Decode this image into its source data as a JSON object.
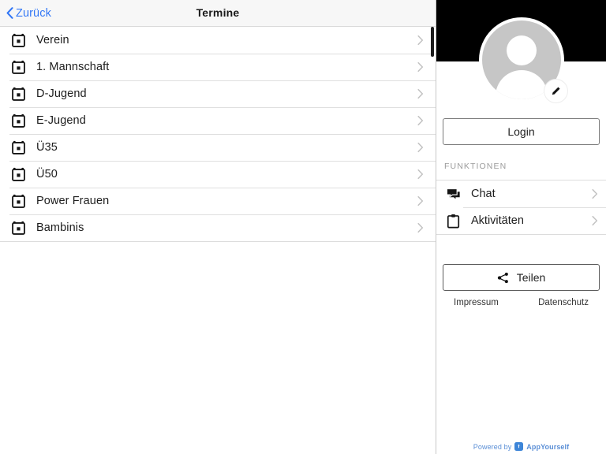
{
  "navbar": {
    "back_label": "Zurück",
    "title": "Termine"
  },
  "appointments": {
    "rows": [
      {
        "label": "Verein",
        "icon": "calendar-icon"
      },
      {
        "label": "1. Mannschaft",
        "icon": "calendar-icon"
      },
      {
        "label": "D-Jugend",
        "icon": "calendar-icon"
      },
      {
        "label": "E-Jugend",
        "icon": "calendar-icon"
      },
      {
        "label": "Ü35",
        "icon": "calendar-icon"
      },
      {
        "label": "Ü50",
        "icon": "calendar-icon"
      },
      {
        "label": "Power Frauen",
        "icon": "calendar-icon"
      },
      {
        "label": "Bambinis",
        "icon": "calendar-icon"
      }
    ]
  },
  "sidebar": {
    "login_label": "Login",
    "section_label": "FUNKTIONEN",
    "functions": [
      {
        "label": "Chat",
        "icon": "chat-bubbles-icon"
      },
      {
        "label": "Aktivitäten",
        "icon": "clipboard-icon"
      }
    ],
    "share_label": "Teilen",
    "share_icon": "share-icon",
    "edit_icon": "pencil-icon",
    "avatar_icon": "person-avatar",
    "legal": [
      {
        "label": "Impressum"
      },
      {
        "label": "Datenschutz"
      }
    ],
    "footer": {
      "powered_text": "Powered by",
      "brand": "AppYourself",
      "badge_icon": "appyourself-badge-icon"
    }
  },
  "colors": {
    "accent_blue": "#3478f6",
    "header_band": "#000000",
    "nav_background": "#f7f7f7",
    "avatar_gray": "#c6c6c6",
    "footer_blue": "#5b8fd6"
  }
}
